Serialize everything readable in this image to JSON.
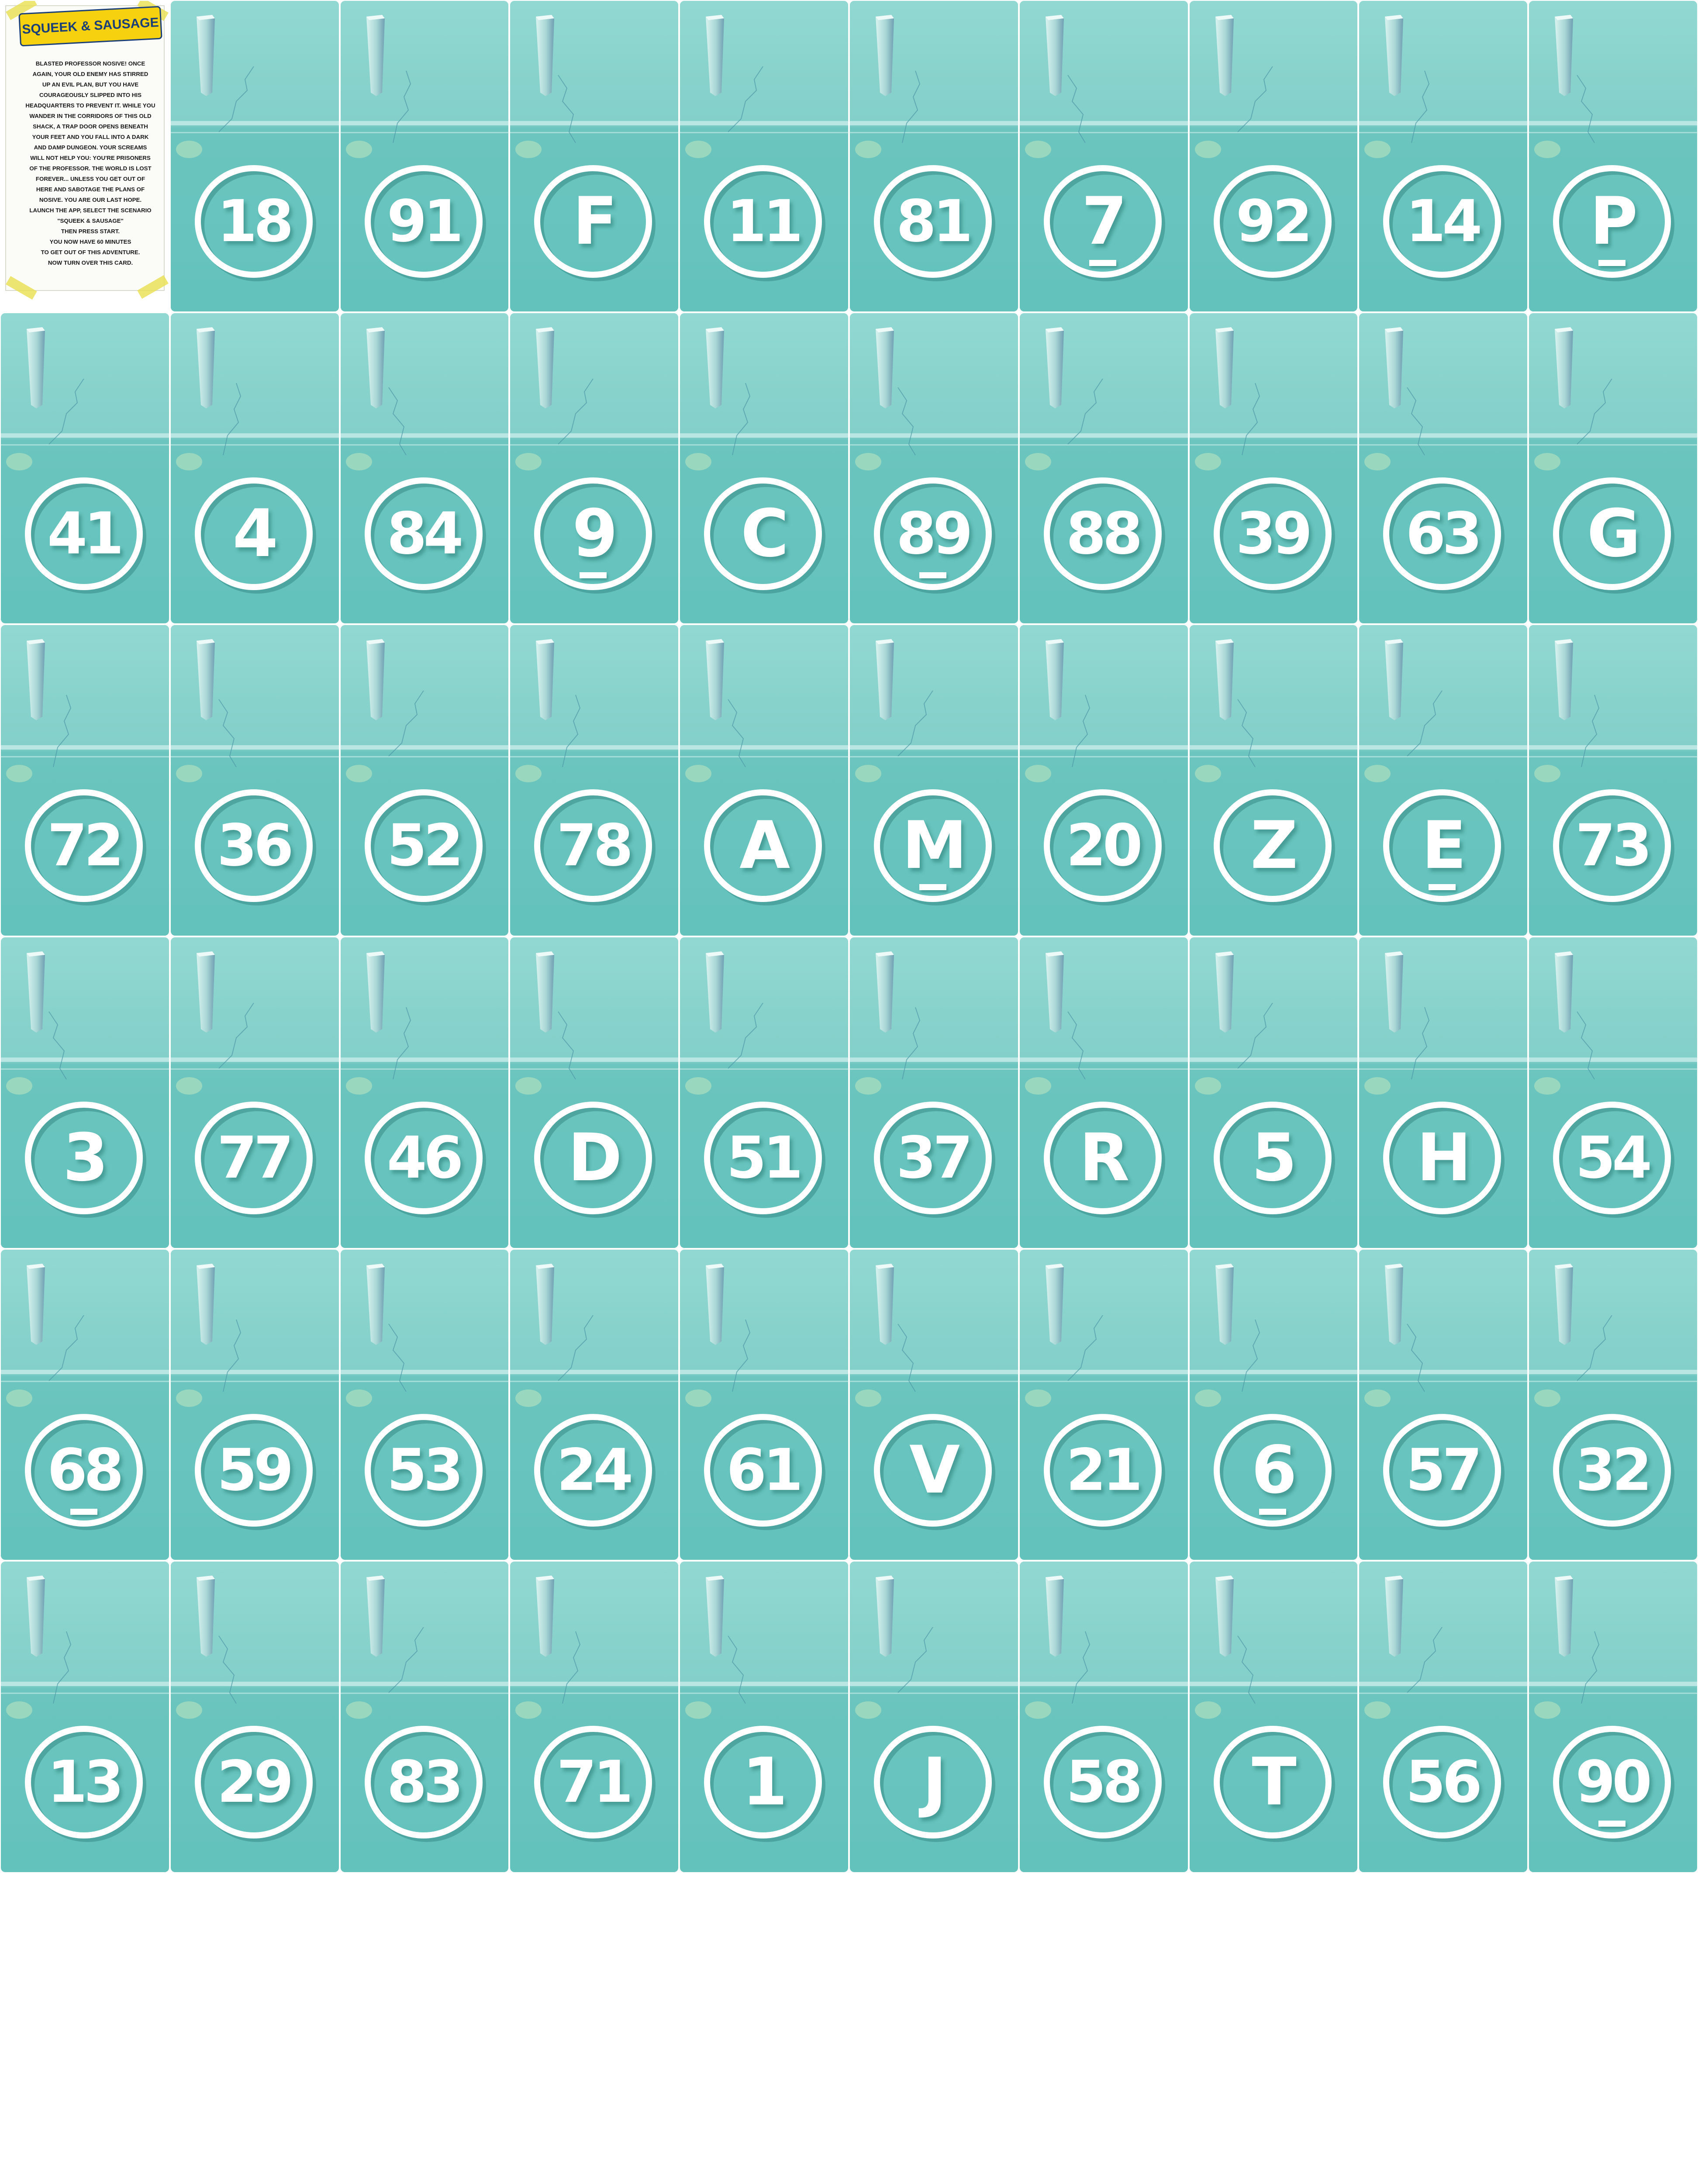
{
  "intro": {
    "logo": "SQUEEK & SAUSAGE",
    "story_lines": [
      "Blasted Professor Nosive! Once",
      "again, your old enemy has stirred",
      "up an evil plan, but you have",
      "courageously slipped into his",
      "headquarters to prevent it. While you",
      "wander in the corridors of this old",
      "shack, a trap door opens beneath",
      "your feet and you fall into a dark",
      "and damp dungeon. Your screams",
      "will not help you: you're prisoners",
      "of the professor. The world is lost",
      "forever... unless you get out of",
      "here and sabotage the plans of",
      "Nosive. You are our last hope.",
      "Launch the app, select the scenario",
      "\"Squeek & Sausage\"",
      "then press START.",
      "You now have 60 minutes",
      "to get out of this adventure.",
      "Now turn over this card."
    ]
  },
  "cards": [
    {
      "label": "18",
      "underline": false
    },
    {
      "label": "91",
      "underline": false
    },
    {
      "label": "F",
      "underline": false
    },
    {
      "label": "11",
      "underline": false
    },
    {
      "label": "81",
      "underline": false
    },
    {
      "label": "7",
      "underline": true
    },
    {
      "label": "92",
      "underline": false
    },
    {
      "label": "14",
      "underline": false
    },
    {
      "label": "P",
      "underline": true
    },
    {
      "label": "41",
      "underline": false
    },
    {
      "label": "4",
      "underline": false
    },
    {
      "label": "84",
      "underline": false
    },
    {
      "label": "9",
      "underline": true
    },
    {
      "label": "C",
      "underline": false
    },
    {
      "label": "89",
      "underline": true
    },
    {
      "label": "88",
      "underline": false
    },
    {
      "label": "39",
      "underline": false
    },
    {
      "label": "63",
      "underline": false
    },
    {
      "label": "G",
      "underline": false
    },
    {
      "label": "72",
      "underline": false
    },
    {
      "label": "36",
      "underline": false
    },
    {
      "label": "52",
      "underline": false
    },
    {
      "label": "78",
      "underline": false
    },
    {
      "label": "A",
      "underline": false
    },
    {
      "label": "M",
      "underline": true
    },
    {
      "label": "20",
      "underline": false
    },
    {
      "label": "Z",
      "underline": false
    },
    {
      "label": "E",
      "underline": true
    },
    {
      "label": "73",
      "underline": false
    },
    {
      "label": "3",
      "underline": false
    },
    {
      "label": "77",
      "underline": false
    },
    {
      "label": "46",
      "underline": false
    },
    {
      "label": "D",
      "underline": false
    },
    {
      "label": "51",
      "underline": false
    },
    {
      "label": "37",
      "underline": false
    },
    {
      "label": "R",
      "underline": false
    },
    {
      "label": "5",
      "underline": false
    },
    {
      "label": "H",
      "underline": false
    },
    {
      "label": "54",
      "underline": false
    },
    {
      "label": "68",
      "underline": true
    },
    {
      "label": "59",
      "underline": false
    },
    {
      "label": "53",
      "underline": false
    },
    {
      "label": "24",
      "underline": false
    },
    {
      "label": "61",
      "underline": false
    },
    {
      "label": "V",
      "underline": false
    },
    {
      "label": "21",
      "underline": false
    },
    {
      "label": "6",
      "underline": true
    },
    {
      "label": "57",
      "underline": false
    },
    {
      "label": "32",
      "underline": false
    },
    {
      "label": "13",
      "underline": false
    },
    {
      "label": "29",
      "underline": false
    },
    {
      "label": "83",
      "underline": false
    },
    {
      "label": "71",
      "underline": false
    },
    {
      "label": "1",
      "underline": false
    },
    {
      "label": "J",
      "underline": false
    },
    {
      "label": "58",
      "underline": false
    },
    {
      "label": "T",
      "underline": false
    },
    {
      "label": "56",
      "underline": false
    },
    {
      "label": "90",
      "underline": true
    }
  ],
  "colors": {
    "card_wall": "#86d2cc",
    "card_floor": "#63c2bc",
    "label": "#ffffff",
    "logo_yellow": "#f6d10f",
    "logo_blue": "#1a3f78"
  }
}
